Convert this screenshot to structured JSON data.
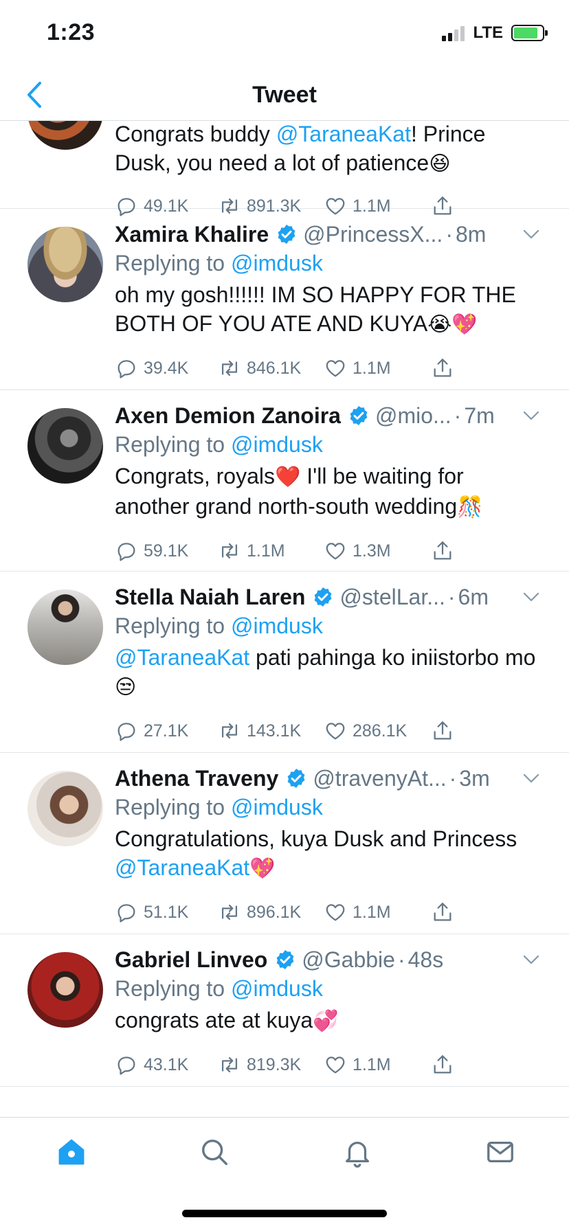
{
  "status_bar": {
    "time": "1:23",
    "network": "LTE"
  },
  "nav": {
    "title": "Tweet"
  },
  "tweets": [
    {
      "name": "",
      "handle": "",
      "time": "",
      "replying_label": "",
      "replying_to": "",
      "text_parts": [
        "Congrats buddy ",
        "@TaraneaKat",
        "! Prince Dusk, you need a lot of patience",
        "😆"
      ],
      "stats": {
        "replies": "49.1K",
        "retweets": "891.3K",
        "likes": "1.1M"
      }
    },
    {
      "name": "Xamira Khalire",
      "handle": "@PrincessX...",
      "time": "8m",
      "replying_label": "Replying to",
      "replying_to": "@imdusk",
      "text_parts": [
        "oh my gosh!!!!!! IM SO HAPPY FOR THE BOTH OF YOU ATE AND KUYA",
        "😭💖"
      ],
      "stats": {
        "replies": "39.4K",
        "retweets": "846.1K",
        "likes": "1.1M"
      }
    },
    {
      "name": "Axen Demion Zanoira",
      "handle": "@mio...",
      "time": "7m",
      "replying_label": "Replying to",
      "replying_to": "@imdusk",
      "text_parts": [
        "Congrats, royals",
        "❤️",
        " I'll be waiting for another grand north-south wedding",
        "🎊"
      ],
      "stats": {
        "replies": "59.1K",
        "retweets": "1.1M",
        "likes": "1.3M"
      }
    },
    {
      "name": "Stella Naiah Laren",
      "handle": "@stelLar...",
      "time": "6m",
      "replying_label": "Replying to",
      "replying_to": "@imdusk",
      "text_parts": [
        "@TaraneaKat",
        " pati pahinga ko iniistorbo mo",
        "😒"
      ],
      "stats": {
        "replies": "27.1K",
        "retweets": "143.1K",
        "likes": "286.1K"
      }
    },
    {
      "name": "Athena Traveny",
      "handle": "@travenyAt...",
      "time": "3m",
      "replying_label": "Replying to",
      "replying_to": "@imdusk",
      "text_parts": [
        "Congratulations, kuya Dusk and Princess ",
        "@TaraneaKat",
        "💖"
      ],
      "stats": {
        "replies": "51.1K",
        "retweets": "896.1K",
        "likes": "1.1M"
      }
    },
    {
      "name": "Gabriel Linveo",
      "handle": "@Gabbie",
      "time": "48s",
      "replying_label": "Replying to",
      "replying_to": "@imdusk",
      "text_parts": [
        "congrats ate at kuya",
        "💞"
      ],
      "stats": {
        "replies": "43.1K",
        "retweets": "819.3K",
        "likes": "1.1M"
      }
    }
  ],
  "tab_bar": {
    "active": "home",
    "items": [
      "home-icon",
      "search-icon",
      "notifications-icon",
      "messages-icon"
    ]
  },
  "colors": {
    "accent": "#1da1f2",
    "muted": "#657786",
    "text": "#14171a"
  }
}
